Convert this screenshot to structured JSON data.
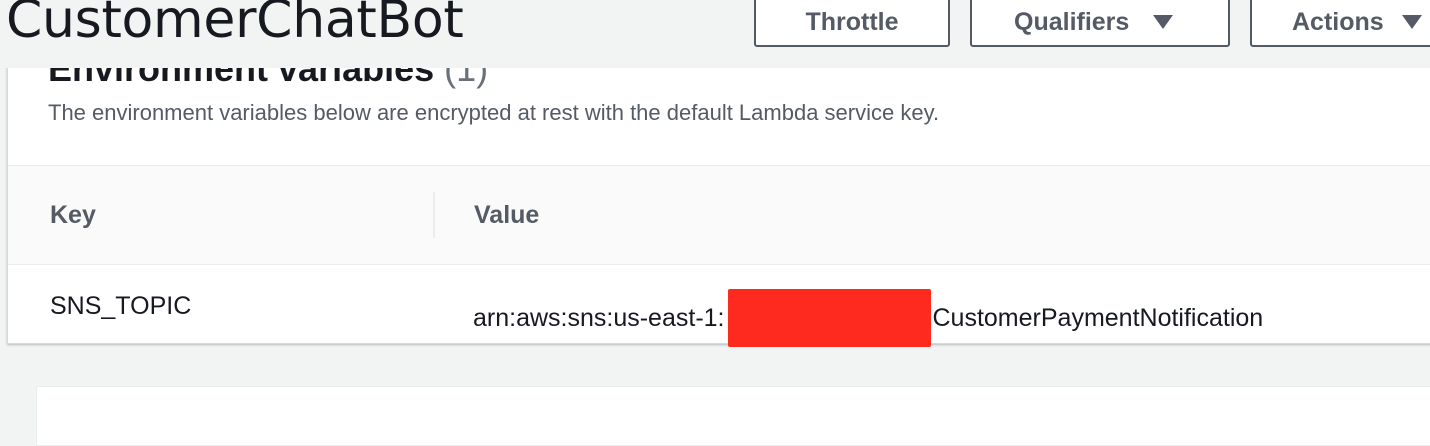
{
  "header": {
    "title": "CustomerChatBot",
    "buttons": {
      "throttle": "Throttle",
      "qualifiers": "Qualifiers",
      "actions": "Actions"
    }
  },
  "env_panel": {
    "heading": "Environment variables",
    "heading_count": "(1)",
    "description": "The environment variables below are encrypted at rest with the default Lambda service key.",
    "columns": {
      "key": "Key",
      "value": "Value"
    },
    "rows": [
      {
        "key": "SNS_TOPIC",
        "value_prefix": "arn:aws:sns:us-east-1:",
        "value_suffix": "CustomerPaymentNotification"
      }
    ]
  },
  "colors": {
    "redaction": "#ff2a1f",
    "button_border": "#545b64",
    "background": "#f2f3f3"
  }
}
